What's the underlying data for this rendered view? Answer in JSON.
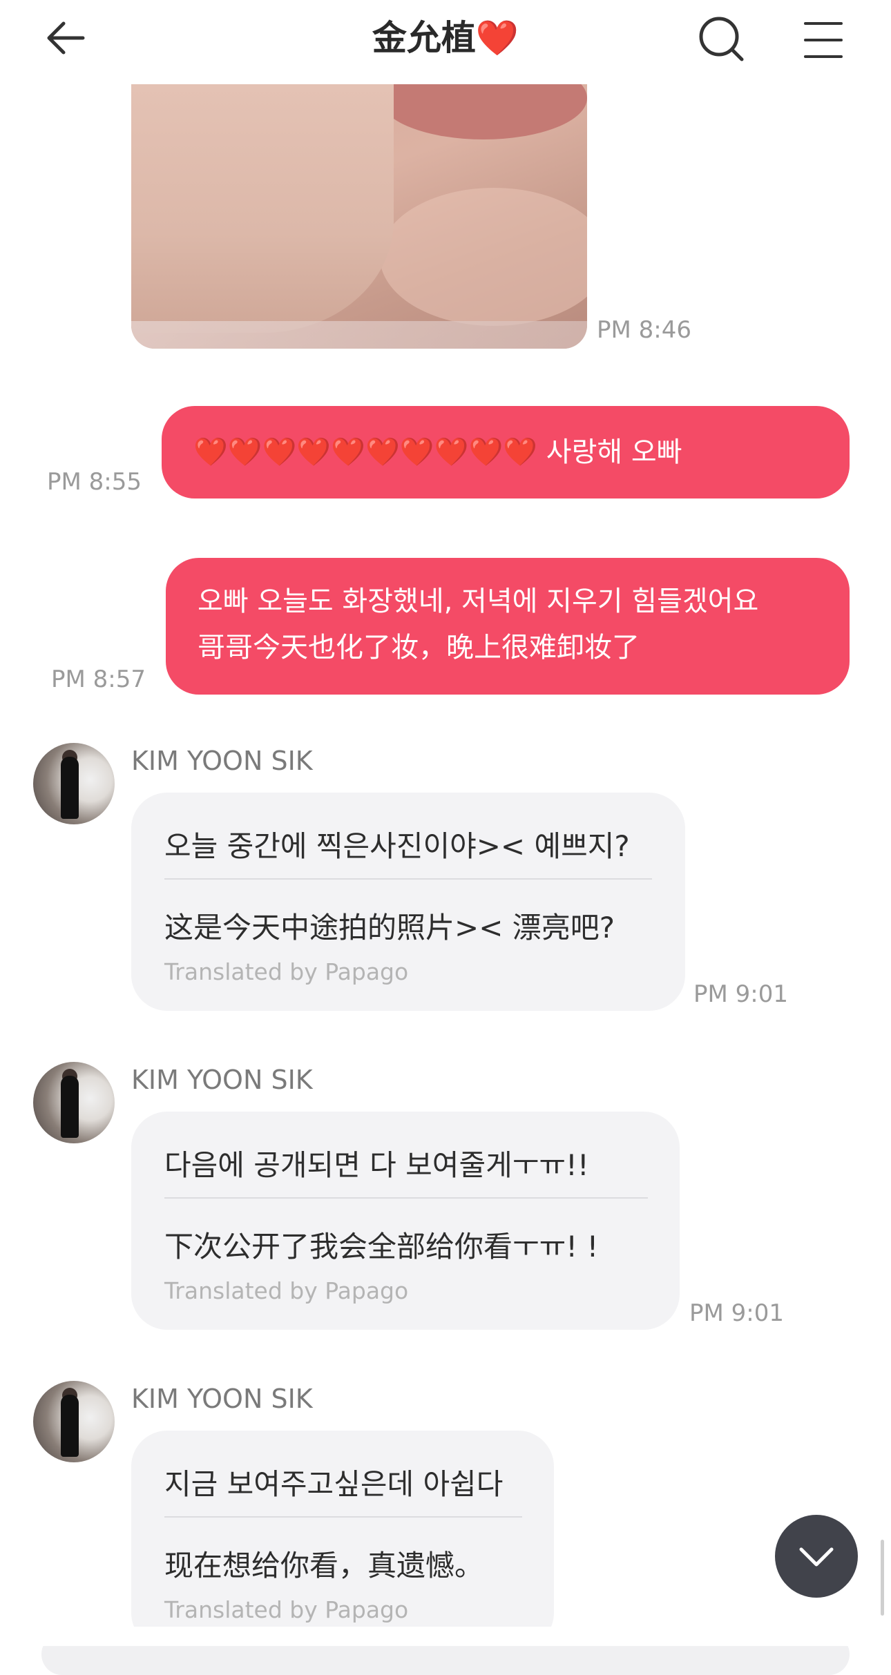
{
  "header": {
    "title": "金允植",
    "title_heart": "❤️"
  },
  "messages": {
    "photo_time": "PM 8:46",
    "out1": {
      "hearts": "❤️❤️❤️❤️❤️❤️❤️❤️❤️❤️",
      "text": "사랑해 오빠",
      "time": "PM 8:55"
    },
    "out2": {
      "line1": "오빠 오늘도 화장했네, 저녁에 지우기 힘들겠어요",
      "line2": "哥哥今天也化了妆，晚上很难卸妆了",
      "time": "PM 8:57"
    },
    "in1": {
      "sender": "KIM YOON SIK",
      "ko": "오늘 중간에 찍은사진이야>< 예쁘지?",
      "zh": "这是今天中途拍的照片>< 漂亮吧?",
      "translated": "Translated by Papago",
      "time": "PM 9:01"
    },
    "in2": {
      "sender": "KIM YOON SIK",
      "ko": "다음에 공개되면 다 보여줄게ㅜㅠ!!",
      "zh": "下次公开了我会全部给你看ㅜㅠ! !",
      "translated": "Translated by Papago",
      "time": "PM 9:01"
    },
    "in3": {
      "sender": "KIM YOON SIK",
      "ko": "지금 보여주고싶은데 아쉽다",
      "zh": "现在想给你看，真遗憾。",
      "translated": "Translated by Papago"
    }
  },
  "icons": {
    "back": "back-arrow-icon",
    "search": "search-icon",
    "menu": "hamburger-menu-icon",
    "scroll": "chevron-down-icon"
  },
  "colors": {
    "outgoing_bubble": "#f44b66",
    "incoming_bubble": "#f3f3f5",
    "scroll_button": "#41434b"
  }
}
